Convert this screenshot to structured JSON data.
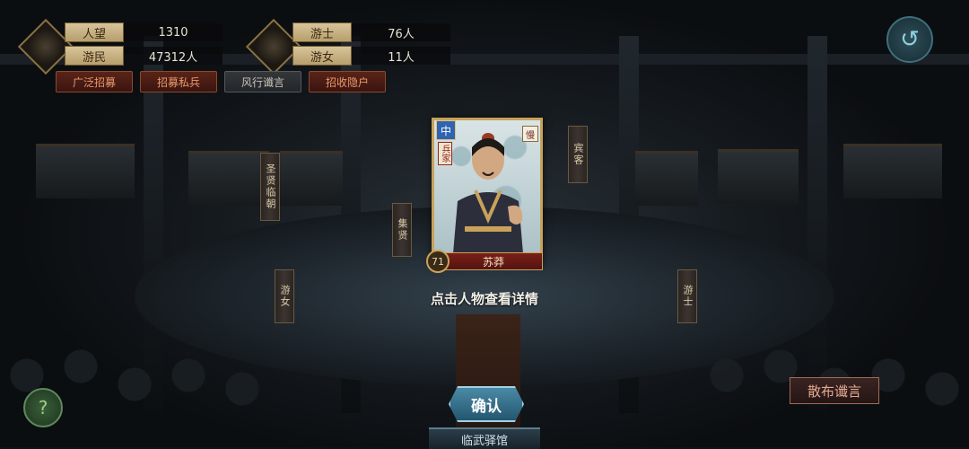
{
  "stats_left": [
    {
      "label": "人望",
      "value": "1310"
    },
    {
      "label": "游民",
      "value": "47312人"
    }
  ],
  "stats_right": [
    {
      "label": "游士",
      "value": "76人"
    },
    {
      "label": "游女",
      "value": "11人"
    }
  ],
  "actions": [
    "广泛招募",
    "招募私兵",
    "风行谶言",
    "招收隐户"
  ],
  "tags": {
    "shengxian": "圣贤临朝",
    "jixian": "集贤",
    "youshi_left": "游女",
    "binke": "宾客",
    "youshi_right": "游士"
  },
  "card": {
    "rank": "中",
    "school": "兵家",
    "speed": "慢",
    "level": "71",
    "name": "苏莽"
  },
  "hint": "点击人物查看详情",
  "confirm_label": "确认",
  "location": "临武驿馆",
  "help_icon": "?",
  "spread_label": "散布谶言",
  "back_icon": "↺"
}
